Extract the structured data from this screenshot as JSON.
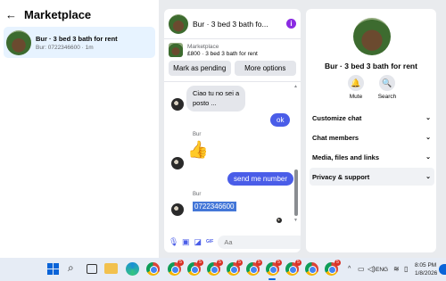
{
  "left": {
    "title": "Marketplace",
    "conversation": {
      "title": "Bur · 3 bed 3 bath for rent",
      "subtitle": "Bur: 0722346600 · 1m"
    }
  },
  "chat": {
    "header_title": "Bur · 3 bed 3 bath fo...",
    "listing_source": "Marketplace",
    "listing_price": "£800 · 3 bed 3 bath for rent",
    "mark_pending_label": "Mark as pending",
    "more_options_label": "More options",
    "messages": {
      "incoming_1": "Ciao tu no sei a\nposto ...",
      "outgoing_1": "ok",
      "sender_1": "Bur",
      "outgoing_2": "send me number",
      "sender_2": "Bur",
      "incoming_phone": "0722346600"
    },
    "composer_placeholder": "Aa"
  },
  "info_panel": {
    "title": "Bur · 3 bed 3 bath for rent",
    "mute_label": "Mute",
    "search_label": "Search",
    "sections": [
      "Customize chat",
      "Chat members",
      "Media, files and links",
      "Privacy & support"
    ]
  },
  "taskbar": {
    "language": "ENG",
    "time": "8:05 PM",
    "date": "1/8/2026",
    "chrome_badges": [
      "5",
      "5",
      "5",
      "5",
      "5",
      "5",
      "5",
      "5"
    ]
  },
  "colors": {
    "accent": "#4a5de8",
    "highlight": "#e7f3ff",
    "info_icon": "#8a2be2"
  }
}
